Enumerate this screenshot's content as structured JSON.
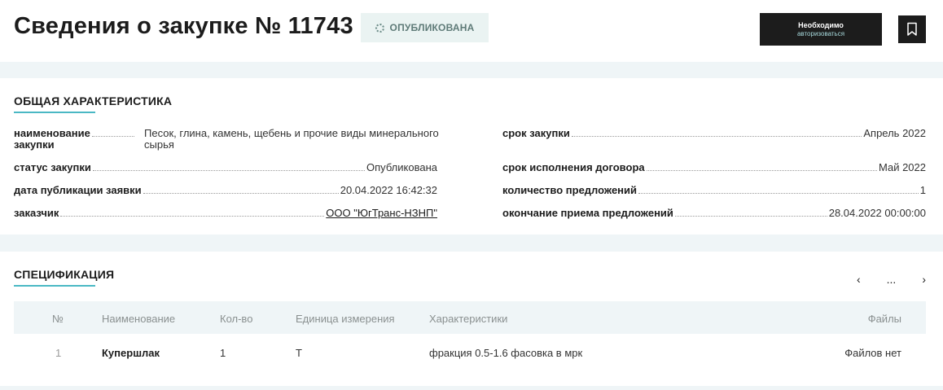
{
  "header": {
    "title": "Сведения о закупке № 11743",
    "status": "ОПУБЛИКОВАНА",
    "auth_line1": "Необходимо",
    "auth_line2": "авторизоваться"
  },
  "general": {
    "title": "ОБЩАЯ ХАРАКТЕРИСТИКА",
    "name_key_1": "наименование",
    "name_key_2": "закупки",
    "name_value_1": "Песок, глина, камень, щебень и прочие виды минерального",
    "name_value_2": "сырья",
    "status_key": "статус закупки",
    "status_value": "Опубликована",
    "pubdate_key": "дата публикации заявки",
    "pubdate_value": "20.04.2022 16:42:32",
    "customer_key": "заказчик",
    "customer_value": "ООО \"ЮгТранс-НЗНП\"",
    "term_key": "срок закупки",
    "term_value": "Апрель 2022",
    "exec_key": "срок исполнения договора",
    "exec_value": "Май 2022",
    "offers_key": "количество предложений",
    "offers_value": "1",
    "end_key": "окончание приема предложений",
    "end_value": "28.04.2022 00:00:00"
  },
  "spec": {
    "title": "СПЕЦИФИКАЦИЯ",
    "pager_prev": "‹",
    "pager_dots": "...",
    "pager_next": "›",
    "columns": {
      "num": "№",
      "name": "Наименование",
      "qty": "Кол-во",
      "unit": "Единица измерения",
      "chars": "Характеристики",
      "files": "Файлы"
    },
    "rows": [
      {
        "num": "1",
        "name": "Купершлак",
        "qty": "1",
        "unit": "Т",
        "chars": "фракция 0.5-1.6 фасовка в мрк",
        "files": "Файлов нет"
      }
    ]
  }
}
